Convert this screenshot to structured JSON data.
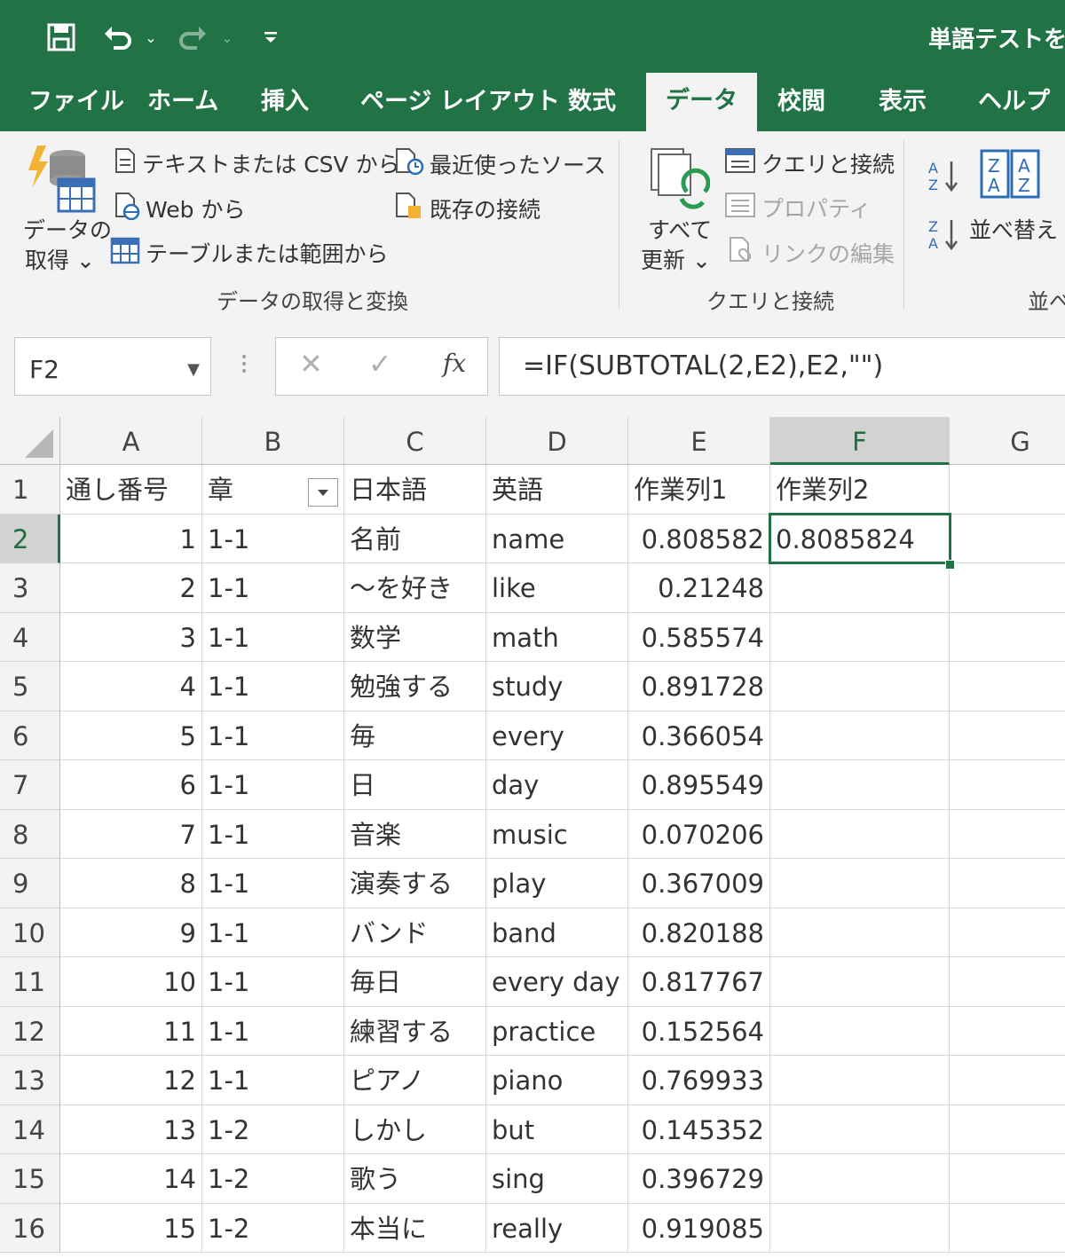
{
  "window": {
    "title": "単語テストを作"
  },
  "qat": {
    "save_icon": "save-icon",
    "undo_icon": "undo-icon",
    "redo_icon": "redo-icon",
    "customize_icon": "customize-qat-icon"
  },
  "tabs": [
    {
      "label": "ファイル"
    },
    {
      "label": "ホーム"
    },
    {
      "label": "挿入"
    },
    {
      "label": "ページ レイアウト"
    },
    {
      "label": "数式"
    },
    {
      "label": "データ"
    },
    {
      "label": "校閲"
    },
    {
      "label": "表示"
    },
    {
      "label": "ヘルプ"
    }
  ],
  "ribbon": {
    "get_data_line1": "データの",
    "get_data_line2": "取得 ⌄",
    "from_text_csv": "テキストまたは CSV から",
    "from_web": "Web から",
    "from_table": "テーブルまたは範囲から",
    "recent_sources": "最近使ったソース",
    "existing_connections": "既存の接続",
    "group_get_transform": "データの取得と変換",
    "refresh_all_line1": "すべて",
    "refresh_all_line2": "更新 ⌄",
    "queries_connections": "クエリと接続",
    "properties": "プロパティ",
    "edit_links": "リンクの編集",
    "group_queries": "クエリと接続",
    "sort": "並べ替え",
    "group_sort": "並べ"
  },
  "formula_bar": {
    "name_box": "F2",
    "cancel": "✕",
    "enter": "✓",
    "fx": "fx",
    "formula": "=IF(SUBTOTAL(2,E2),E2,\"\")"
  },
  "sheet": {
    "columns": [
      "A",
      "B",
      "C",
      "D",
      "E",
      "F",
      "G"
    ],
    "header_row": {
      "num": "1",
      "cells": [
        "通し番号",
        "章",
        "日本語",
        "英語",
        "作業列1",
        "作業列2",
        ""
      ]
    },
    "rows": [
      {
        "num": "2",
        "a": "1",
        "b": "1-1",
        "c": "名前",
        "d": "name",
        "e": "0.808582",
        "f": "0.8085824"
      },
      {
        "num": "3",
        "a": "2",
        "b": "1-1",
        "c": "～を好き",
        "d": "like",
        "e": "0.21248",
        "f": ""
      },
      {
        "num": "4",
        "a": "3",
        "b": "1-1",
        "c": "数学",
        "d": "math",
        "e": "0.585574",
        "f": ""
      },
      {
        "num": "5",
        "a": "4",
        "b": "1-1",
        "c": "勉強する",
        "d": "study",
        "e": "0.891728",
        "f": ""
      },
      {
        "num": "6",
        "a": "5",
        "b": "1-1",
        "c": "毎",
        "d": "every",
        "e": "0.366054",
        "f": ""
      },
      {
        "num": "7",
        "a": "6",
        "b": "1-1",
        "c": "日",
        "d": "day",
        "e": "0.895549",
        "f": ""
      },
      {
        "num": "8",
        "a": "7",
        "b": "1-1",
        "c": "音楽",
        "d": "music",
        "e": "0.070206",
        "f": ""
      },
      {
        "num": "9",
        "a": "8",
        "b": "1-1",
        "c": "演奏する",
        "d": "play",
        "e": "0.367009",
        "f": ""
      },
      {
        "num": "10",
        "a": "9",
        "b": "1-1",
        "c": "バンド",
        "d": "band",
        "e": "0.820188",
        "f": ""
      },
      {
        "num": "11",
        "a": "10",
        "b": "1-1",
        "c": "毎日",
        "d": "every day",
        "e": "0.817767",
        "f": ""
      },
      {
        "num": "12",
        "a": "11",
        "b": "1-1",
        "c": "練習する",
        "d": "practice",
        "e": "0.152564",
        "f": ""
      },
      {
        "num": "13",
        "a": "12",
        "b": "1-1",
        "c": "ピアノ",
        "d": "piano",
        "e": "0.769933",
        "f": ""
      },
      {
        "num": "14",
        "a": "13",
        "b": "1-2",
        "c": "しかし",
        "d": "but",
        "e": "0.145352",
        "f": ""
      },
      {
        "num": "15",
        "a": "14",
        "b": "1-2",
        "c": "歌う",
        "d": "sing",
        "e": "0.396729",
        "f": ""
      },
      {
        "num": "16",
        "a": "15",
        "b": "1-2",
        "c": "本当に",
        "d": "really",
        "e": "0.919085",
        "f": ""
      }
    ],
    "selected_cell": "F2",
    "accent_color": "#217346"
  }
}
